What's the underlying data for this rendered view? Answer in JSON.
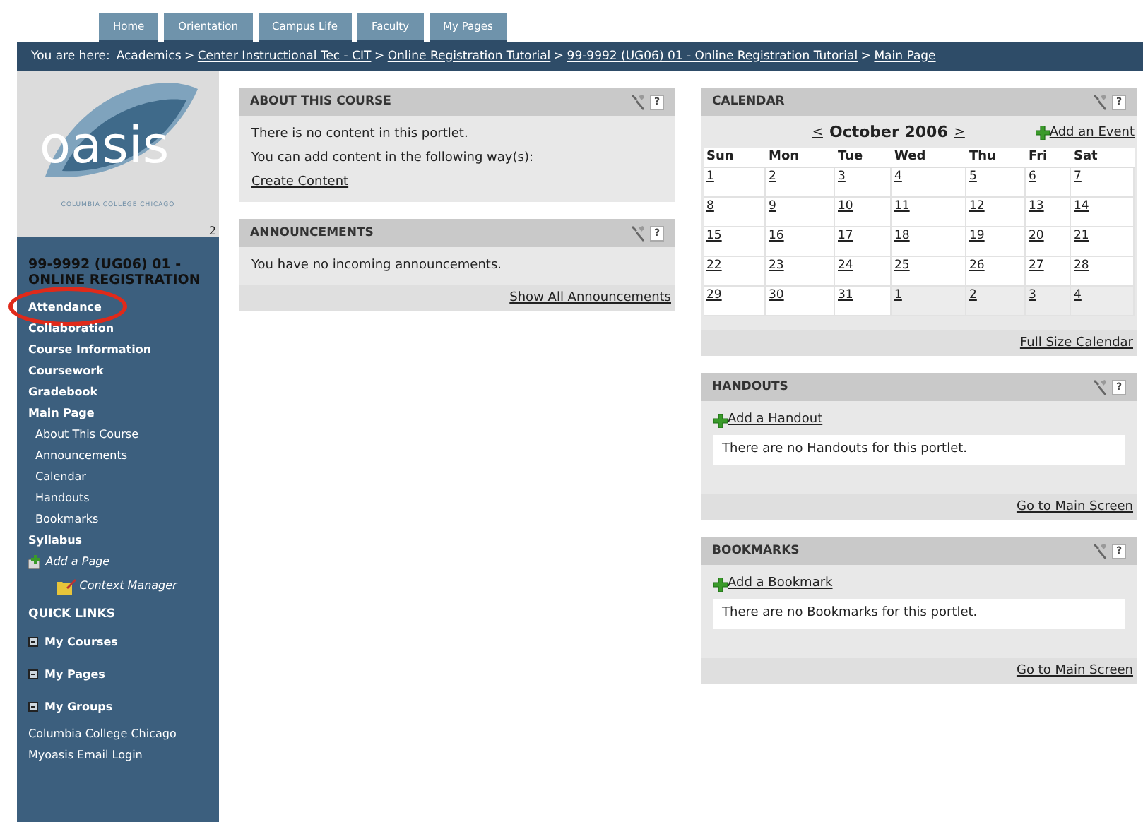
{
  "tabs": [
    {
      "label": "Home",
      "selected": false
    },
    {
      "label": "Orientation",
      "selected": false
    },
    {
      "label": "Campus Life",
      "selected": false
    },
    {
      "label": "Faculty",
      "selected": false
    },
    {
      "label": "My Pages",
      "selected": false
    }
  ],
  "breadcrumb": {
    "prefix": "You are here:",
    "items": [
      {
        "label": "Academics",
        "link": false
      },
      {
        "label": "Center Instructional Tec - CIT",
        "link": true
      },
      {
        "label": "Online Registration Tutorial",
        "link": true
      },
      {
        "label": "99-9992 (UG06) 01 - Online Registration Tutorial",
        "link": true
      },
      {
        "label": "Main Page",
        "link": true
      }
    ],
    "separator": ">"
  },
  "logo": {
    "word": "oasis",
    "subtitle": "COLUMBIA COLLEGE CHICAGO",
    "corner_mark": "2"
  },
  "sidebar": {
    "items": [
      {
        "kind": "title",
        "label": "99-9992 (UG06) 01 - ONLINE REGISTRATION",
        "circled": false
      },
      {
        "kind": "section",
        "label": "Attendance",
        "circled": true
      },
      {
        "kind": "section",
        "label": "Collaboration",
        "circled": false
      },
      {
        "kind": "section",
        "label": "Course Information",
        "circled": false
      },
      {
        "kind": "section",
        "label": "Coursework",
        "circled": false
      },
      {
        "kind": "section",
        "label": "Gradebook",
        "circled": false
      },
      {
        "kind": "section",
        "label": "Main Page",
        "circled": false
      },
      {
        "kind": "sub",
        "label": "About This Course",
        "circled": false
      },
      {
        "kind": "sub",
        "label": "Announcements",
        "circled": false
      },
      {
        "kind": "sub",
        "label": "Calendar",
        "circled": false
      },
      {
        "kind": "sub",
        "label": "Handouts",
        "circled": false
      },
      {
        "kind": "sub",
        "label": "Bookmarks",
        "circled": false
      },
      {
        "kind": "section",
        "label": "Syllabus",
        "circled": false
      },
      {
        "kind": "add",
        "label": "Add a Page",
        "circled": false
      },
      {
        "kind": "context",
        "label": "Context Manager",
        "circled": false
      },
      {
        "kind": "heading",
        "label": "QUICK LINKS",
        "circled": false
      },
      {
        "kind": "toggle",
        "label": "My Courses",
        "circled": false
      },
      {
        "kind": "toggle",
        "label": "My Pages",
        "circled": false
      },
      {
        "kind": "toggle",
        "label": "My Groups",
        "circled": false
      },
      {
        "kind": "link",
        "label": "Columbia College Chicago",
        "circled": false
      },
      {
        "kind": "link",
        "label": "Myoasis Email Login",
        "circled": false
      }
    ]
  },
  "columns": [
    [
      {
        "title": "ABOUT THIS COURSE",
        "help": "?",
        "body": [
          {
            "kind": "text",
            "text": "There is no content in this portlet."
          },
          {
            "kind": "text",
            "text": "You can add content in the following way(s):"
          },
          {
            "kind": "link",
            "text": "Create Content"
          }
        ]
      },
      {
        "title": "ANNOUNCEMENTS",
        "help": "?",
        "body": [
          {
            "kind": "text",
            "text": "You have no incoming announcements."
          }
        ],
        "footer": "Show All Announcements"
      }
    ],
    [
      {
        "title": "CALENDAR",
        "help": "?",
        "calendar": {
          "prev": "<",
          "month": "October 2006",
          "next": ">",
          "add": "Add an Event",
          "weekdays": [
            "Sun",
            "Mon",
            "Tue",
            "Wed",
            "Thu",
            "Fri",
            "Sat"
          ],
          "weeks": [
            [
              {
                "day": "1",
                "other_month": false
              },
              {
                "day": "2",
                "other_month": false
              },
              {
                "day": "3",
                "other_month": false
              },
              {
                "day": "4",
                "other_month": false
              },
              {
                "day": "5",
                "other_month": false
              },
              {
                "day": "6",
                "other_month": false
              },
              {
                "day": "7",
                "other_month": false
              }
            ],
            [
              {
                "day": "8",
                "other_month": false
              },
              {
                "day": "9",
                "other_month": false
              },
              {
                "day": "10",
                "other_month": false
              },
              {
                "day": "11",
                "other_month": false
              },
              {
                "day": "12",
                "other_month": false
              },
              {
                "day": "13",
                "other_month": false
              },
              {
                "day": "14",
                "other_month": false
              }
            ],
            [
              {
                "day": "15",
                "other_month": false
              },
              {
                "day": "16",
                "other_month": false
              },
              {
                "day": "17",
                "other_month": false
              },
              {
                "day": "18",
                "other_month": false
              },
              {
                "day": "19",
                "other_month": false
              },
              {
                "day": "20",
                "other_month": false
              },
              {
                "day": "21",
                "other_month": false
              }
            ],
            [
              {
                "day": "22",
                "other_month": false
              },
              {
                "day": "23",
                "other_month": false
              },
              {
                "day": "24",
                "other_month": false
              },
              {
                "day": "25",
                "other_month": false
              },
              {
                "day": "26",
                "other_month": false
              },
              {
                "day": "27",
                "other_month": false
              },
              {
                "day": "28",
                "other_month": false
              }
            ],
            [
              {
                "day": "29",
                "other_month": false
              },
              {
                "day": "30",
                "other_month": false
              },
              {
                "day": "31",
                "other_month": false
              },
              {
                "day": "1",
                "other_month": true
              },
              {
                "day": "2",
                "other_month": true
              },
              {
                "day": "3",
                "other_month": true
              },
              {
                "day": "4",
                "other_month": true
              }
            ]
          ]
        },
        "footer": "Full Size Calendar"
      },
      {
        "title": "HANDOUTS",
        "help": "?",
        "body": [
          {
            "kind": "add",
            "text": "Add a Handout"
          },
          {
            "kind": "notice",
            "text": "There are no Handouts for this portlet."
          }
        ],
        "footer": "Go to Main Screen"
      },
      {
        "title": "BOOKMARKS",
        "help": "?",
        "body": [
          {
            "kind": "add",
            "text": "Add a Bookmark"
          },
          {
            "kind": "notice",
            "text": "There are no Bookmarks for this portlet."
          }
        ],
        "footer": "Go to Main Screen"
      }
    ]
  ]
}
